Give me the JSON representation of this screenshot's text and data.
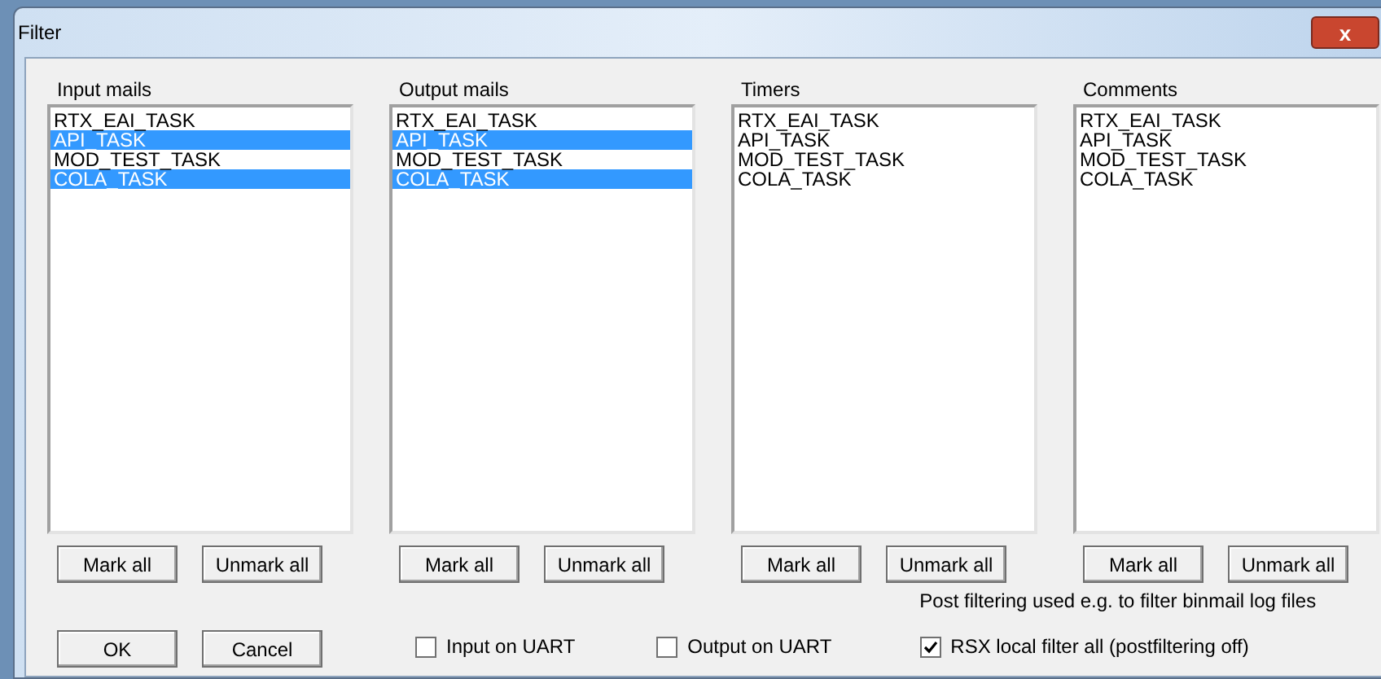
{
  "window": {
    "title": "Filter",
    "close": "x"
  },
  "lists": [
    {
      "title": "Input mails",
      "items": [
        {
          "label": "RTX_EAI_TASK",
          "selected": false
        },
        {
          "label": "API_TASK",
          "selected": true
        },
        {
          "label": "MOD_TEST_TASK",
          "selected": false
        },
        {
          "label": "COLA_TASK",
          "selected": true
        }
      ],
      "buttons": [
        "Mark all",
        "Unmark all"
      ]
    },
    {
      "title": "Output mails",
      "items": [
        {
          "label": "RTX_EAI_TASK",
          "selected": false
        },
        {
          "label": "API_TASK",
          "selected": true
        },
        {
          "label": "MOD_TEST_TASK",
          "selected": false
        },
        {
          "label": "COLA_TASK",
          "selected": true
        }
      ],
      "buttons": [
        "Mark all",
        "Unmark all"
      ]
    },
    {
      "title": "Timers",
      "items": [
        {
          "label": "RTX_EAI_TASK",
          "selected": false
        },
        {
          "label": "API_TASK",
          "selected": false
        },
        {
          "label": "MOD_TEST_TASK",
          "selected": false
        },
        {
          "label": "COLA_TASK",
          "selected": false
        }
      ],
      "buttons": [
        "Mark all",
        "Unmark all"
      ]
    },
    {
      "title": "Comments",
      "items": [
        {
          "label": "RTX_EAI_TASK",
          "selected": false
        },
        {
          "label": "API_TASK",
          "selected": false
        },
        {
          "label": "MOD_TEST_TASK",
          "selected": false
        },
        {
          "label": "COLA_TASK",
          "selected": false
        }
      ],
      "buttons": [
        "Mark all",
        "Unmark all"
      ]
    }
  ],
  "dialog_buttons": [
    "OK",
    "Cancel"
  ],
  "uart_options": [
    {
      "label": "Input on UART",
      "checked": false
    },
    {
      "label": "Output on UART",
      "checked": false
    }
  ],
  "post_filter": {
    "note": "Post filtering used e.g. to filter binmail log files",
    "option": {
      "label": "RSX local filter all (postfiltering off)",
      "checked": true
    }
  }
}
